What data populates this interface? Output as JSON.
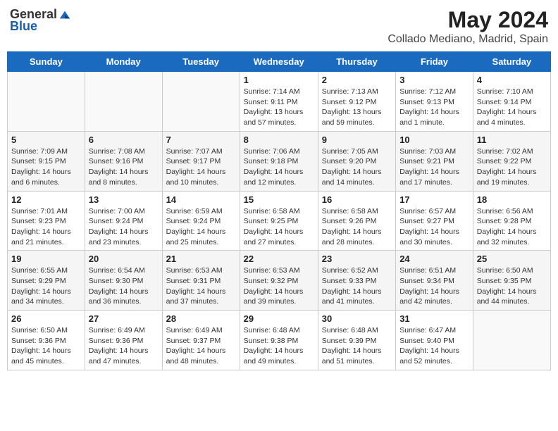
{
  "header": {
    "logo_general": "General",
    "logo_blue": "Blue",
    "title": "May 2024",
    "subtitle": "Collado Mediano, Madrid, Spain"
  },
  "weekdays": [
    "Sunday",
    "Monday",
    "Tuesday",
    "Wednesday",
    "Thursday",
    "Friday",
    "Saturday"
  ],
  "weeks": [
    [
      {
        "day": "",
        "info": ""
      },
      {
        "day": "",
        "info": ""
      },
      {
        "day": "",
        "info": ""
      },
      {
        "day": "1",
        "info": "Sunrise: 7:14 AM\nSunset: 9:11 PM\nDaylight: 13 hours and 57 minutes."
      },
      {
        "day": "2",
        "info": "Sunrise: 7:13 AM\nSunset: 9:12 PM\nDaylight: 13 hours and 59 minutes."
      },
      {
        "day": "3",
        "info": "Sunrise: 7:12 AM\nSunset: 9:13 PM\nDaylight: 14 hours and 1 minute."
      },
      {
        "day": "4",
        "info": "Sunrise: 7:10 AM\nSunset: 9:14 PM\nDaylight: 14 hours and 4 minutes."
      }
    ],
    [
      {
        "day": "5",
        "info": "Sunrise: 7:09 AM\nSunset: 9:15 PM\nDaylight: 14 hours and 6 minutes."
      },
      {
        "day": "6",
        "info": "Sunrise: 7:08 AM\nSunset: 9:16 PM\nDaylight: 14 hours and 8 minutes."
      },
      {
        "day": "7",
        "info": "Sunrise: 7:07 AM\nSunset: 9:17 PM\nDaylight: 14 hours and 10 minutes."
      },
      {
        "day": "8",
        "info": "Sunrise: 7:06 AM\nSunset: 9:18 PM\nDaylight: 14 hours and 12 minutes."
      },
      {
        "day": "9",
        "info": "Sunrise: 7:05 AM\nSunset: 9:20 PM\nDaylight: 14 hours and 14 minutes."
      },
      {
        "day": "10",
        "info": "Sunrise: 7:03 AM\nSunset: 9:21 PM\nDaylight: 14 hours and 17 minutes."
      },
      {
        "day": "11",
        "info": "Sunrise: 7:02 AM\nSunset: 9:22 PM\nDaylight: 14 hours and 19 minutes."
      }
    ],
    [
      {
        "day": "12",
        "info": "Sunrise: 7:01 AM\nSunset: 9:23 PM\nDaylight: 14 hours and 21 minutes."
      },
      {
        "day": "13",
        "info": "Sunrise: 7:00 AM\nSunset: 9:24 PM\nDaylight: 14 hours and 23 minutes."
      },
      {
        "day": "14",
        "info": "Sunrise: 6:59 AM\nSunset: 9:24 PM\nDaylight: 14 hours and 25 minutes."
      },
      {
        "day": "15",
        "info": "Sunrise: 6:58 AM\nSunset: 9:25 PM\nDaylight: 14 hours and 27 minutes."
      },
      {
        "day": "16",
        "info": "Sunrise: 6:58 AM\nSunset: 9:26 PM\nDaylight: 14 hours and 28 minutes."
      },
      {
        "day": "17",
        "info": "Sunrise: 6:57 AM\nSunset: 9:27 PM\nDaylight: 14 hours and 30 minutes."
      },
      {
        "day": "18",
        "info": "Sunrise: 6:56 AM\nSunset: 9:28 PM\nDaylight: 14 hours and 32 minutes."
      }
    ],
    [
      {
        "day": "19",
        "info": "Sunrise: 6:55 AM\nSunset: 9:29 PM\nDaylight: 14 hours and 34 minutes."
      },
      {
        "day": "20",
        "info": "Sunrise: 6:54 AM\nSunset: 9:30 PM\nDaylight: 14 hours and 36 minutes."
      },
      {
        "day": "21",
        "info": "Sunrise: 6:53 AM\nSunset: 9:31 PM\nDaylight: 14 hours and 37 minutes."
      },
      {
        "day": "22",
        "info": "Sunrise: 6:53 AM\nSunset: 9:32 PM\nDaylight: 14 hours and 39 minutes."
      },
      {
        "day": "23",
        "info": "Sunrise: 6:52 AM\nSunset: 9:33 PM\nDaylight: 14 hours and 41 minutes."
      },
      {
        "day": "24",
        "info": "Sunrise: 6:51 AM\nSunset: 9:34 PM\nDaylight: 14 hours and 42 minutes."
      },
      {
        "day": "25",
        "info": "Sunrise: 6:50 AM\nSunset: 9:35 PM\nDaylight: 14 hours and 44 minutes."
      }
    ],
    [
      {
        "day": "26",
        "info": "Sunrise: 6:50 AM\nSunset: 9:36 PM\nDaylight: 14 hours and 45 minutes."
      },
      {
        "day": "27",
        "info": "Sunrise: 6:49 AM\nSunset: 9:36 PM\nDaylight: 14 hours and 47 minutes."
      },
      {
        "day": "28",
        "info": "Sunrise: 6:49 AM\nSunset: 9:37 PM\nDaylight: 14 hours and 48 minutes."
      },
      {
        "day": "29",
        "info": "Sunrise: 6:48 AM\nSunset: 9:38 PM\nDaylight: 14 hours and 49 minutes."
      },
      {
        "day": "30",
        "info": "Sunrise: 6:48 AM\nSunset: 9:39 PM\nDaylight: 14 hours and 51 minutes."
      },
      {
        "day": "31",
        "info": "Sunrise: 6:47 AM\nSunset: 9:40 PM\nDaylight: 14 hours and 52 minutes."
      },
      {
        "day": "",
        "info": ""
      }
    ]
  ]
}
